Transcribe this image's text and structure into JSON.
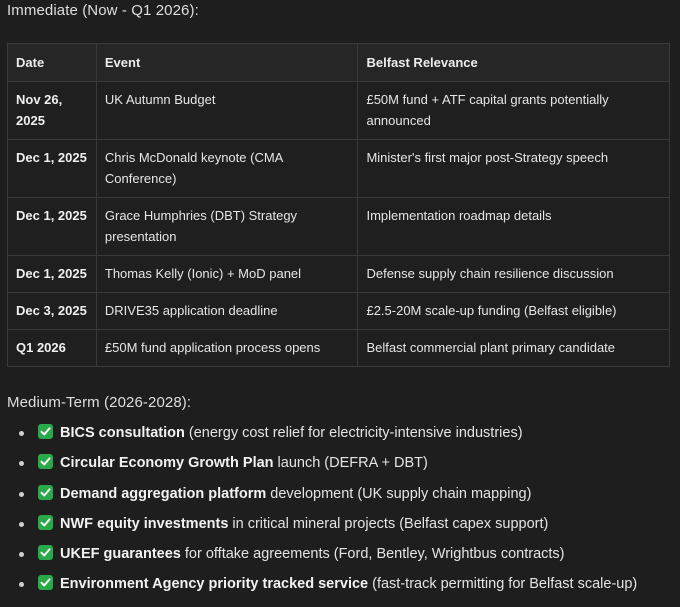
{
  "sections": {
    "immediate_heading": "Immediate (Now - Q1 2026):",
    "medium_heading": "Medium-Term (2026-2028):"
  },
  "table": {
    "headers": [
      "Date",
      "Event",
      "Belfast Relevance"
    ],
    "rows": [
      {
        "date": "Nov 26, 2025",
        "event": "UK Autumn Budget",
        "relevance": "£50M fund + ATF capital grants potentially announced"
      },
      {
        "date": "Dec 1, 2025",
        "event": "Chris McDonald keynote (CMA Conference)",
        "relevance": "Minister's first major post-Strategy speech"
      },
      {
        "date": "Dec 1, 2025",
        "event": "Grace Humphries (DBT) Strategy presentation",
        "relevance": "Implementation roadmap details"
      },
      {
        "date": "Dec 1, 2025",
        "event": "Thomas Kelly (Ionic) + MoD panel",
        "relevance": "Defense supply chain resilience discussion"
      },
      {
        "date": "Dec 3, 2025",
        "event": "DRIVE35 application deadline",
        "relevance": "£2.5-20M scale-up funding (Belfast eligible)"
      },
      {
        "date": "Q1 2026",
        "event": "£50M fund application process opens",
        "relevance": "Belfast commercial plant primary candidate"
      }
    ]
  },
  "medium_items": [
    {
      "icon": "check-mark-icon",
      "bold": "BICS consultation",
      "rest": " (energy cost relief for electricity-intensive industries)"
    },
    {
      "icon": "check-mark-icon",
      "bold": "Circular Economy Growth Plan",
      "rest": " launch (DEFRA + DBT)"
    },
    {
      "icon": "check-mark-icon",
      "bold": "Demand aggregation platform",
      "rest": " development (UK supply chain mapping)"
    },
    {
      "icon": "check-mark-icon",
      "bold": "NWF equity investments",
      "rest": " in critical mineral projects (Belfast capex support)"
    },
    {
      "icon": "check-mark-icon",
      "bold": "UKEF guarantees",
      "rest": " for offtake agreements (Ford, Bentley, Wrightbus contracts)"
    },
    {
      "icon": "check-mark-icon",
      "bold": "Environment Agency priority tracked service",
      "rest": " (fast-track permitting for Belfast scale-up)"
    }
  ],
  "colors": {
    "background": "#1e1e1e",
    "check_green": "#2aa94a",
    "border": "#3a3a3a"
  }
}
